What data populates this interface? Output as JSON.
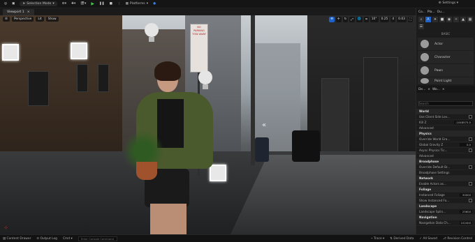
{
  "toolbar": {
    "mode": "Selection Mode",
    "platforms": "Platforms",
    "settings": "Settings"
  },
  "viewport": {
    "tab": "Viewport 1",
    "perspective": "Perspective",
    "lit": "Lit",
    "show": "Show",
    "snap_angle": "10°",
    "snap_grid": "0.25",
    "cam_speed": "4",
    "scale": "0.03"
  },
  "sign": {
    "line1": "NO",
    "line2": "PARKING",
    "line3": "TOW AWAY"
  },
  "panel": {
    "tabs": [
      "Co...",
      "Pla...",
      "Ou..."
    ],
    "section_basic": "BASIC",
    "actors": [
      "Actor",
      "Character",
      "Pawn",
      "Point Light"
    ],
    "detail_tabs": [
      "De...",
      "Wo..."
    ],
    "search_placeholder": "Search",
    "rows": [
      {
        "type": "section",
        "label": "World"
      },
      {
        "type": "check",
        "label": "Use Client Side Lev..."
      },
      {
        "type": "value",
        "label": "Kill Z",
        "value": "-1048575.0"
      },
      {
        "type": "plain",
        "label": "Advanced"
      },
      {
        "type": "section",
        "label": "Physics"
      },
      {
        "type": "check",
        "label": "Override World Gra..."
      },
      {
        "type": "value",
        "label": "Global Gravity Z",
        "value": "0.0"
      },
      {
        "type": "check",
        "label": "Async Physics Tic..."
      },
      {
        "type": "plain",
        "label": "Advanced"
      },
      {
        "type": "section",
        "label": "Broadphase"
      },
      {
        "type": "check",
        "label": "Override Default Br..."
      },
      {
        "type": "plain",
        "label": "Broadphase Settings"
      },
      {
        "type": "section",
        "label": "Network"
      },
      {
        "type": "check",
        "label": "Enable Actors as..."
      },
      {
        "type": "section",
        "label": "Foliage"
      },
      {
        "type": "value",
        "label": "Instanced Foliage",
        "value": "30000"
      },
      {
        "type": "check",
        "label": "Show Instanced Fo..."
      },
      {
        "type": "section",
        "label": "Landscape"
      },
      {
        "type": "value",
        "label": "Landscape Splin...",
        "value": "25600"
      },
      {
        "type": "section",
        "label": "Navigation"
      },
      {
        "type": "value",
        "label": "Navigation Data Ch...",
        "value": "102400"
      }
    ]
  },
  "bottom": {
    "content_drawer": "Content Drawer",
    "output_log": "Output Log",
    "cmd": "Cmd",
    "console_placeholder": "Enter Console Command",
    "trace": "Trace",
    "derived_data": "Derived Data",
    "all_saved": "All Saved",
    "revision_control": "Revision Control"
  }
}
